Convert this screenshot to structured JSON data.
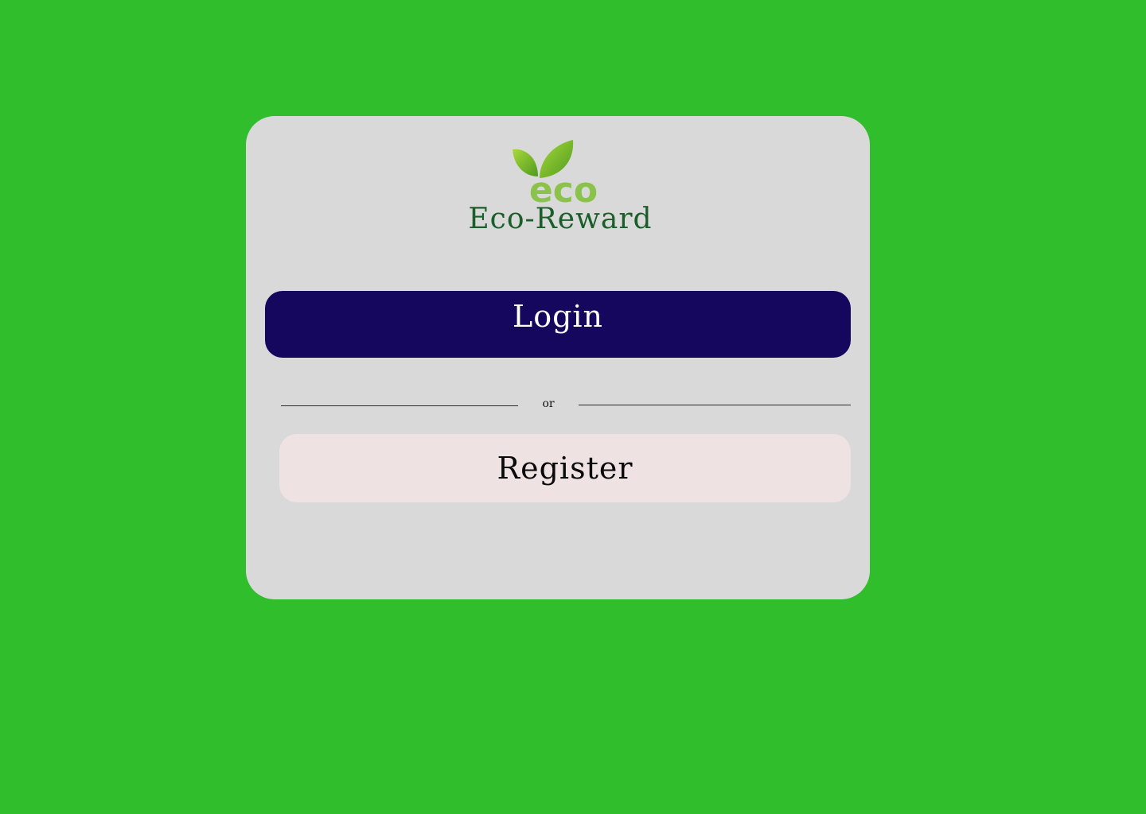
{
  "brand": {
    "logo_icon": "leaf-eco-logo-icon",
    "logo_text": "eco",
    "app_name": "Eco-Reward"
  },
  "actions": {
    "login_label": "Login",
    "divider_text": "or",
    "register_label": "Register"
  },
  "colors": {
    "background": "#30be2c",
    "card": "#d9d9d9",
    "login_button": "#16075e",
    "register_button": "#efe2e3",
    "app_name": "#1b5e2a",
    "logo_green": "#8bc34a"
  }
}
